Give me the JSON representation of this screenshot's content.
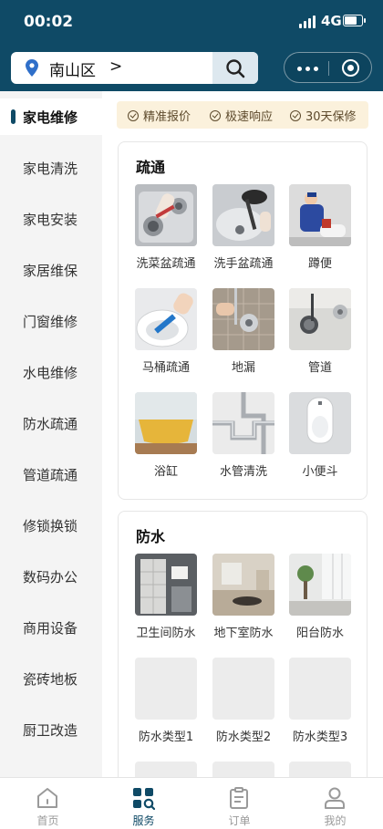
{
  "status_bar": {
    "time": "00:02",
    "network": "4G"
  },
  "header": {
    "location": "南山区",
    "location_chevron": ">"
  },
  "colors": {
    "brand": "#0f4a66",
    "promo_bg": "#fbf1dc",
    "promo_text": "#5d4a2c"
  },
  "promo": [
    "精准报价",
    "极速响应",
    "30天保修"
  ],
  "sidebar": {
    "items": [
      {
        "label": "家电维修",
        "active": true
      },
      {
        "label": "家电清洗"
      },
      {
        "label": "家电安装"
      },
      {
        "label": "家居维保"
      },
      {
        "label": "门窗维修"
      },
      {
        "label": "水电维修"
      },
      {
        "label": "防水疏通"
      },
      {
        "label": "管道疏通"
      },
      {
        "label": "修锁换锁"
      },
      {
        "label": "数码办公"
      },
      {
        "label": "商用设备"
      },
      {
        "label": "瓷砖地板"
      },
      {
        "label": "厨卫改造"
      }
    ]
  },
  "sections": [
    {
      "title": "疏通",
      "items": [
        {
          "label": "洗菜盆疏通",
          "image": "kitchen-sink-photo"
        },
        {
          "label": "洗手盆疏通",
          "image": "washbasin-plunger-photo"
        },
        {
          "label": "蹲便",
          "image": "plumber-squat-toilet-photo"
        },
        {
          "label": "马桶疏通",
          "image": "toilet-brush-photo"
        },
        {
          "label": "地漏",
          "image": "floor-drain-photo"
        },
        {
          "label": "管道",
          "image": "pipe-snake-drain-photo"
        },
        {
          "label": "浴缸",
          "image": "bathtub-photo"
        },
        {
          "label": "水管清洗",
          "image": "chrome-pipes-photo"
        },
        {
          "label": "小便斗",
          "image": "urinal-photo"
        }
      ]
    },
    {
      "title": "防水",
      "items": [
        {
          "label": "卫生间防水",
          "image": "bathroom-photo"
        },
        {
          "label": "地下室防水",
          "image": "basement-room-photo"
        },
        {
          "label": "阳台防水",
          "image": "balcony-photo"
        },
        {
          "label": "防水类型1",
          "image": "placeholder"
        },
        {
          "label": "防水类型2",
          "image": "placeholder"
        },
        {
          "label": "防水类型3",
          "image": "placeholder"
        }
      ]
    }
  ],
  "tabbar": [
    {
      "label": "首页",
      "icon": "home-icon"
    },
    {
      "label": "服务",
      "icon": "service-icon",
      "active": true
    },
    {
      "label": "订单",
      "icon": "order-icon"
    },
    {
      "label": "我的",
      "icon": "profile-icon"
    }
  ]
}
